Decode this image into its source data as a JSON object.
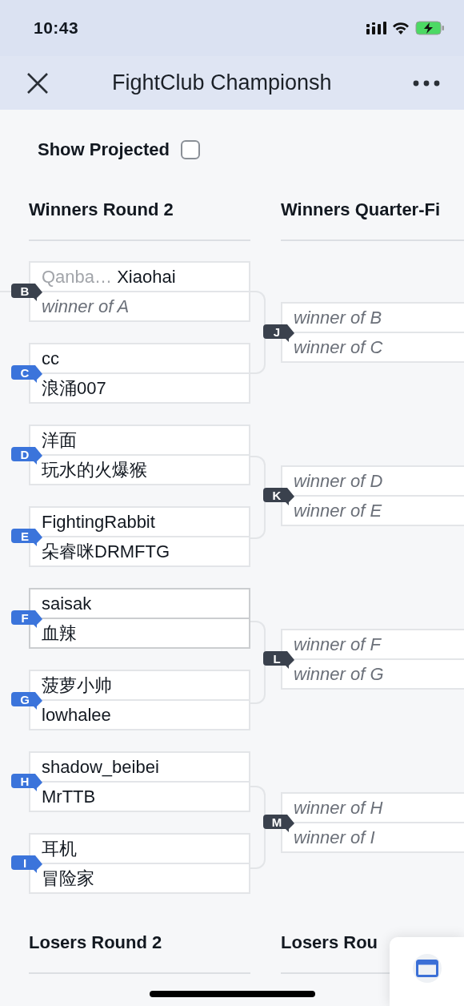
{
  "status_bar": {
    "time": "10:43"
  },
  "nav": {
    "title": "FightClub Championsh"
  },
  "show_projected": {
    "label": "Show Projected",
    "checked": false
  },
  "sections": [
    {
      "columns": [
        {
          "title": "Winners Round 2",
          "matches": [
            {
              "badge": "B",
              "color": "#3a414d",
              "incoming": true,
              "highlighted": false,
              "slots": [
                {
                  "kind": "player",
                  "prefix": "Qanba…",
                  "name": "Xiaohai"
                },
                {
                  "kind": "pending",
                  "name": "winner of A"
                }
              ]
            },
            {
              "badge": "C",
              "color": "#3b74db",
              "highlighted": false,
              "slots": [
                {
                  "kind": "player",
                  "name": "cc"
                },
                {
                  "kind": "player",
                  "name": "浪涌007"
                }
              ]
            },
            {
              "badge": "D",
              "color": "#3b74db",
              "highlighted": false,
              "slots": [
                {
                  "kind": "player",
                  "name": "洋面"
                },
                {
                  "kind": "player",
                  "name": "玩水的火爆猴"
                }
              ]
            },
            {
              "badge": "E",
              "color": "#3b74db",
              "highlighted": false,
              "slots": [
                {
                  "kind": "player",
                  "name": "FightingRabbit"
                },
                {
                  "kind": "player",
                  "name": "朵睿咪DRMFTG"
                }
              ]
            },
            {
              "badge": "F",
              "color": "#3b74db",
              "highlighted": true,
              "slots": [
                {
                  "kind": "player",
                  "name": "saisak"
                },
                {
                  "kind": "player",
                  "name": "血辣"
                }
              ]
            },
            {
              "badge": "G",
              "color": "#3b74db",
              "highlighted": false,
              "slots": [
                {
                  "kind": "player",
                  "name": "菠萝小帅"
                },
                {
                  "kind": "player",
                  "name": "lowhalee"
                }
              ]
            },
            {
              "badge": "H",
              "color": "#3b74db",
              "highlighted": false,
              "slots": [
                {
                  "kind": "player",
                  "name": "shadow_beibei"
                },
                {
                  "kind": "player",
                  "name": "MrTTB"
                }
              ]
            },
            {
              "badge": "I",
              "color": "#3b74db",
              "highlighted": false,
              "slots": [
                {
                  "kind": "player",
                  "name": "耳机"
                },
                {
                  "kind": "player",
                  "name": "冒险家"
                }
              ]
            }
          ]
        },
        {
          "title": "Winners Quarter-Fi",
          "matches": [
            {
              "badge": "J",
              "color": "#3a414d",
              "highlighted": false,
              "slots": [
                {
                  "kind": "pending",
                  "name": "winner of B"
                },
                {
                  "kind": "pending",
                  "name": "winner of C"
                }
              ]
            },
            {
              "badge": "K",
              "color": "#3a414d",
              "highlighted": false,
              "slots": [
                {
                  "kind": "pending",
                  "name": "winner of D"
                },
                {
                  "kind": "pending",
                  "name": "winner of E"
                }
              ]
            },
            {
              "badge": "L",
              "color": "#3a414d",
              "highlighted": false,
              "slots": [
                {
                  "kind": "pending",
                  "name": "winner of F"
                },
                {
                  "kind": "pending",
                  "name": "winner of G"
                }
              ]
            },
            {
              "badge": "M",
              "color": "#3a414d",
              "highlighted": false,
              "slots": [
                {
                  "kind": "pending",
                  "name": "winner of H"
                },
                {
                  "kind": "pending",
                  "name": "winner of I"
                }
              ]
            }
          ]
        }
      ]
    },
    {
      "columns": [
        {
          "title": "Losers Round 2"
        },
        {
          "title": "Losers Rou"
        }
      ]
    }
  ]
}
